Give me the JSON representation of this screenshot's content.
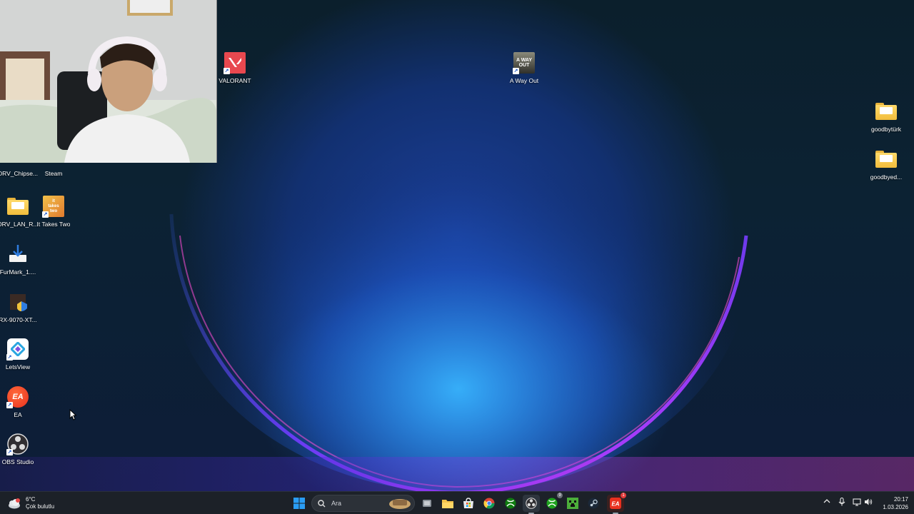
{
  "desktop": {
    "icons": {
      "valorant": {
        "label": "VALORANT",
        "icon": "valorant-icon"
      },
      "a_way_out": {
        "label": "A Way Out",
        "icon": "a-way-out-icon"
      },
      "goodbyturk": {
        "label": "goodbytürk",
        "icon": "folder-icon"
      },
      "goodbyed": {
        "label": "goodbyed...",
        "icon": "folder-icon"
      },
      "drv_chipset": {
        "label": "DRV_Chipse...",
        "icon": "folder-icon"
      },
      "steam": {
        "label": "Steam",
        "icon": "steam-icon"
      },
      "drv_lan": {
        "label": "DRV_LAN_R...",
        "icon": "folder-icon"
      },
      "it_takes_two": {
        "label": "It Takes Two",
        "icon": "it-takes-two-icon"
      },
      "furmark": {
        "label": "FurMark_1....",
        "icon": "installer-icon"
      },
      "rx9070": {
        "label": "RX-9070-XT...",
        "icon": "amd-installer-icon"
      },
      "letsview": {
        "label": "LetsView",
        "icon": "letsview-icon"
      },
      "ea": {
        "label": "EA",
        "icon": "ea-icon"
      },
      "obs": {
        "label": "OBS Studio",
        "icon": "obs-icon"
      }
    }
  },
  "taskbar": {
    "weather": {
      "temp": "6°C",
      "condition": "Çok bulutlu"
    },
    "search": {
      "placeholder": "Ara"
    },
    "clock": {
      "time": "20:17",
      "date": "1.03.2026"
    },
    "apps": [
      "start-button",
      "search",
      "task-view",
      "file-explorer",
      "microsoft-store",
      "chrome",
      "xbox",
      "obs",
      "xbox-app",
      "minecraft",
      "steam",
      "ea-app"
    ],
    "badges": {
      "obs_badge": "",
      "xbox_badge": "9",
      "ea_badge": "1"
    },
    "colors": {
      "background": "#1c2128",
      "accent": "#0a84ff"
    }
  }
}
